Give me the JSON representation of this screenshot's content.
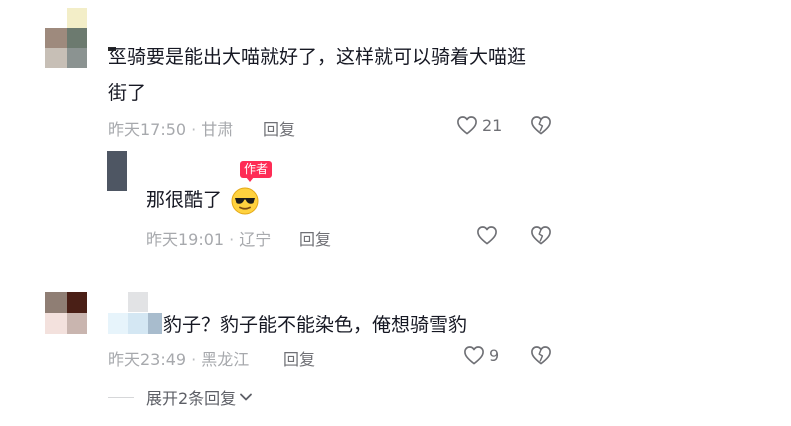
{
  "comments": [
    {
      "text_line1": "巠骑要是能出大喵就好了，这样就可以骑着大喵逛",
      "text_line2": "街了",
      "time": "昨天17:50",
      "location": "甘肃",
      "reply_label": "回复",
      "like_count": "21"
    },
    {
      "badge": "作者",
      "text": "那很酷了",
      "emoji": "cool-face-emoji",
      "time": "昨天19:01",
      "location": "辽宁",
      "reply_label": "回复"
    },
    {
      "text": "豹子？豹子能不能染色，俺想骑雪豹",
      "prefix": "i.",
      "time": "昨天23:49",
      "location": "黑龙江",
      "reply_label": "回复",
      "like_count": "9"
    }
  ],
  "expand_replies": "展开2条回复",
  "icons": {
    "like": "heart-outline-icon",
    "dislike": "broken-heart-icon",
    "chevron": "chevron-down-icon"
  },
  "colors": {
    "badge": "#fe2c55",
    "meta": "#a7a9ad",
    "text": "#161823"
  }
}
